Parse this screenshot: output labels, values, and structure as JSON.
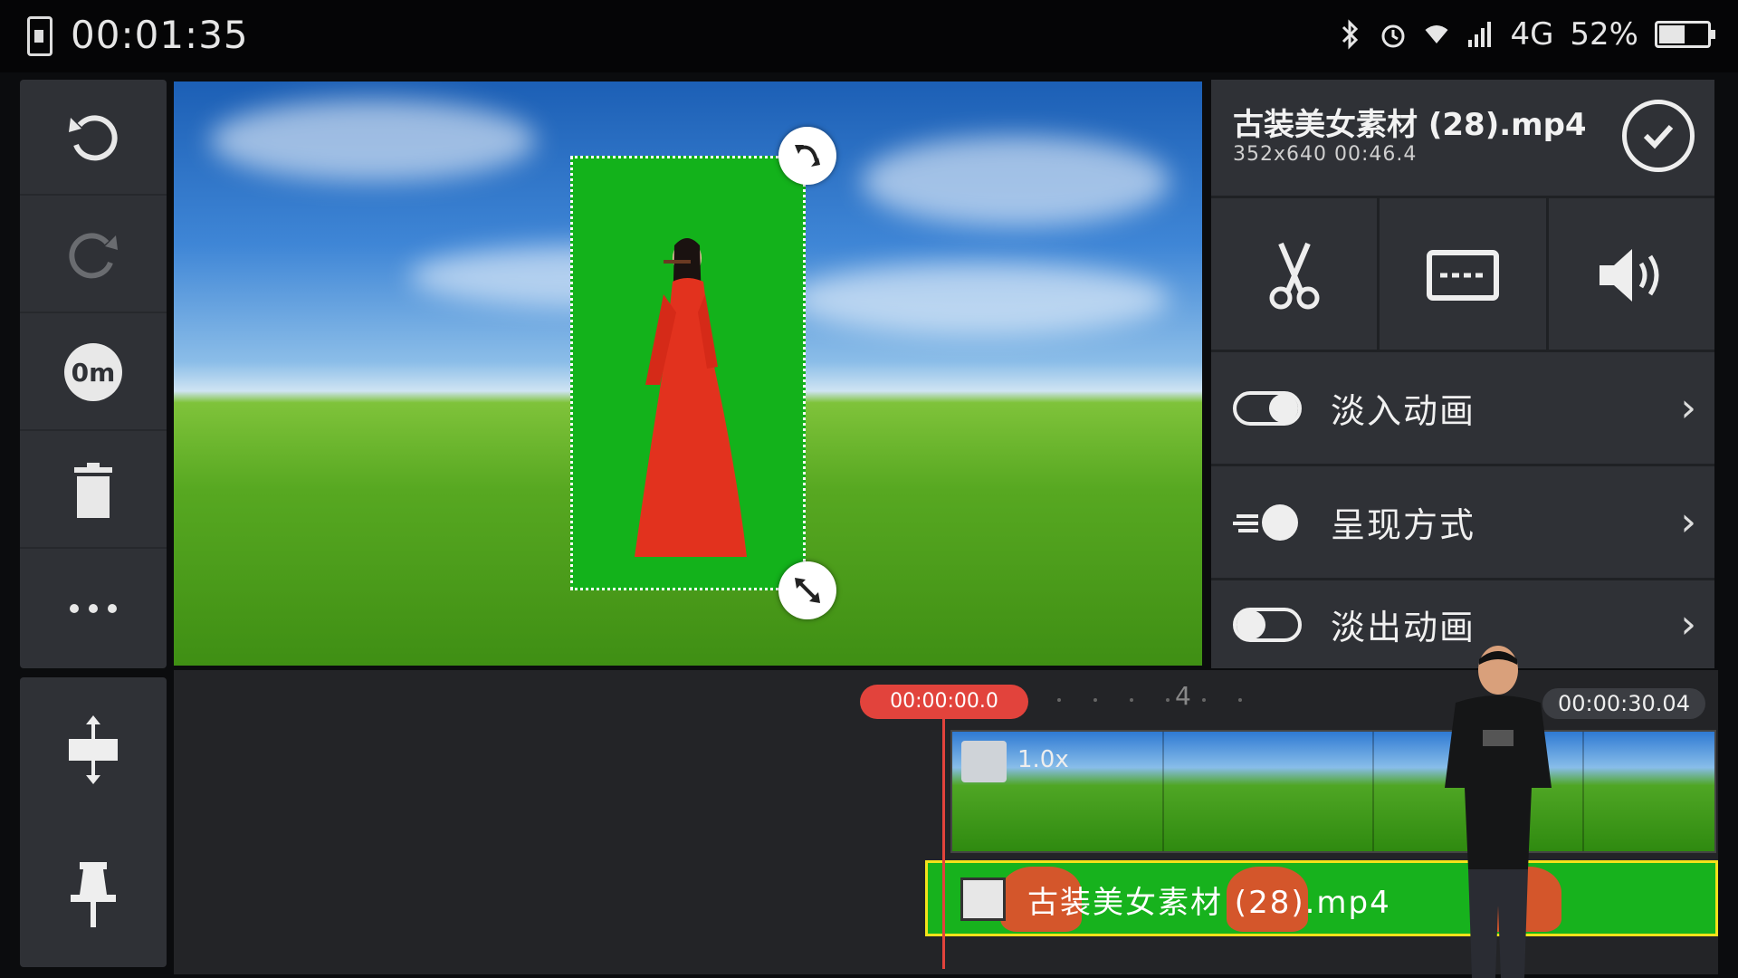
{
  "status_bar": {
    "timer": "00:01:35",
    "network": "4G",
    "battery": "52%"
  },
  "left_toolbar": {
    "items": [
      {
        "icon": "undo-icon"
      },
      {
        "icon": "redo-icon"
      },
      {
        "icon": "keyframe-icon"
      },
      {
        "icon": "trash-icon"
      },
      {
        "icon": "more-icon"
      }
    ]
  },
  "clip_panel": {
    "filename": "古装美女素材 (28).mp4",
    "info": "352x640  00:46.4",
    "tools": [
      "cut-icon",
      "subtitle-icon",
      "volume-icon"
    ],
    "rows": [
      {
        "label": "淡入动画",
        "icon": "fade-in-toggle-icon"
      },
      {
        "label": "呈现方式",
        "icon": "presentation-icon"
      },
      {
        "label": "淡出动画",
        "icon": "fade-out-toggle-icon"
      }
    ]
  },
  "timeline": {
    "playhead_time": "00:00:00.0",
    "end_time": "00:00:30.04",
    "ruler_mark": "4",
    "track1_speed": "1.0x",
    "track2_label": "古装美女素材 (28).mp4"
  },
  "colors": {
    "accent_red": "#e2433c",
    "chroma_green": "#13b21b",
    "selection_yellow": "#f4e21a",
    "panel_bg": "#2f3136"
  }
}
